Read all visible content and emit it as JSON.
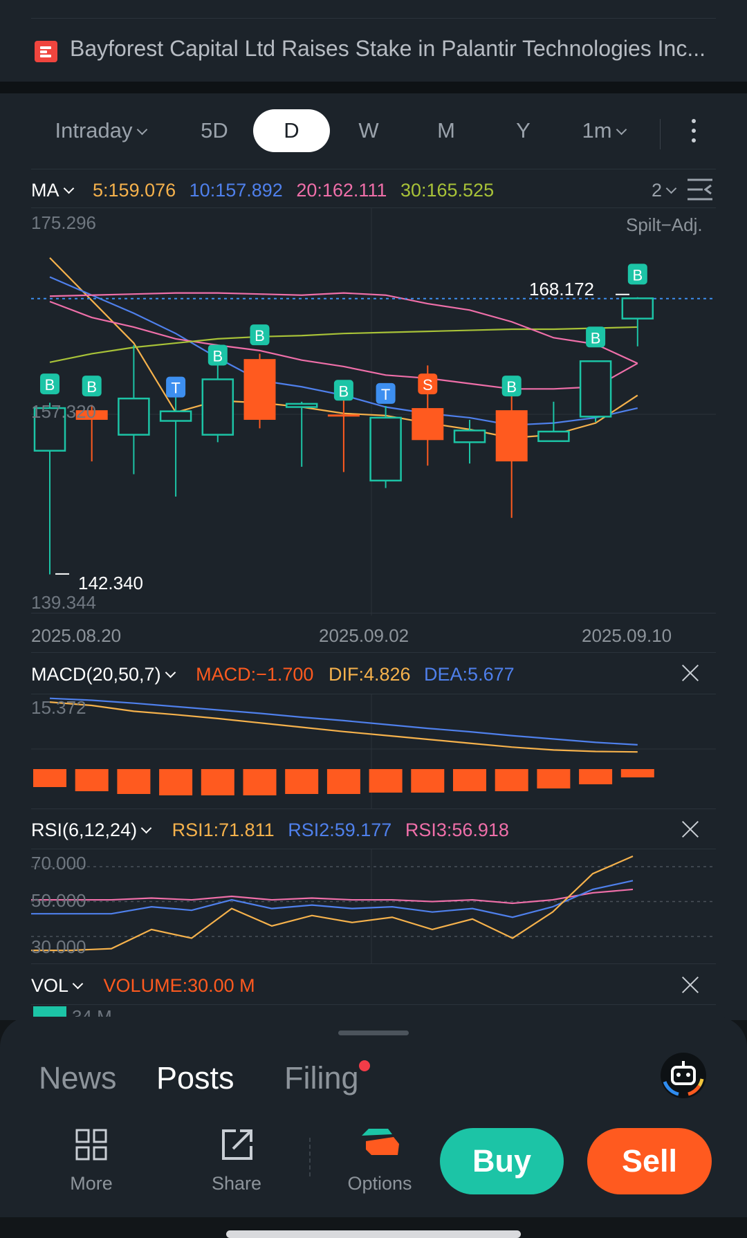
{
  "news": {
    "text": "Bayforest Capital Ltd Raises Stake in Palantir Technologies Inc..."
  },
  "tabs": {
    "intraday": "Intraday",
    "five_day": "5D",
    "day": "D",
    "week": "W",
    "month": "M",
    "year": "Y",
    "interval": "1m"
  },
  "ma": {
    "label": "MA",
    "ma5": "5:159.076",
    "ma10": "10:157.892",
    "ma20": "20:162.111",
    "ma30": "30:165.525",
    "layout_count": "2",
    "split_adj": "Spilt−Adj.",
    "colors": {
      "ma5": "#f6b24c",
      "ma10": "#4f80ec",
      "ma20": "#ef6fa9",
      "ma30": "#a8c238"
    }
  },
  "price_chart": {
    "y_top": "175.296",
    "y_mid": "157.320",
    "y_bottom": "139.344",
    "high_marker": "168.172",
    "low_marker": "142.340",
    "dates": [
      "2025.08.20",
      "2025.09.02",
      "2025.09.10"
    ]
  },
  "chart_data": {
    "type": "candlestick",
    "ylim": [
      139.344,
      175.296
    ],
    "candles": [
      {
        "open": 153.9,
        "close": 157.9,
        "high": 158.4,
        "low": 142.3,
        "up": true,
        "marker": "B"
      },
      {
        "open": 157.7,
        "close": 156.8,
        "high": 158.2,
        "low": 152.9,
        "up": false,
        "marker": "B"
      },
      {
        "open": 155.4,
        "close": 158.8,
        "high": 163.8,
        "low": 151.7,
        "up": true,
        "marker": ""
      },
      {
        "open": 156.7,
        "close": 157.6,
        "high": 159.2,
        "low": 149.6,
        "up": true,
        "marker": "T"
      },
      {
        "open": 155.4,
        "close": 160.6,
        "high": 162.6,
        "low": 154.7,
        "up": true,
        "marker": "B"
      },
      {
        "open": 162.5,
        "close": 156.8,
        "high": 163.0,
        "low": 156.0,
        "up": false,
        "marker": "B"
      },
      {
        "open": 158.0,
        "close": 158.3,
        "high": 158.5,
        "low": 152.4,
        "up": true,
        "marker": ""
      },
      {
        "open": 157.3,
        "close": 157.2,
        "high": 158.9,
        "low": 151.9,
        "up": false,
        "marker": "B"
      },
      {
        "open": 151.1,
        "close": 157.0,
        "high": 158.1,
        "low": 150.4,
        "up": true,
        "marker": "T"
      },
      {
        "open": 157.9,
        "close": 154.9,
        "high": 161.9,
        "low": 152.5,
        "up": false,
        "marker": "S"
      },
      {
        "open": 154.7,
        "close": 155.8,
        "high": 156.8,
        "low": 152.7,
        "up": true,
        "marker": ""
      },
      {
        "open": 157.7,
        "close": 152.9,
        "high": 159.3,
        "low": 147.6,
        "up": false,
        "marker": "B"
      },
      {
        "open": 154.8,
        "close": 155.7,
        "high": 158.5,
        "low": 154.8,
        "up": true,
        "marker": ""
      },
      {
        "open": 157.1,
        "close": 162.3,
        "high": 162.3,
        "low": 156.6,
        "up": true,
        "marker": "B"
      },
      {
        "open": 166.3,
        "close": 168.2,
        "high": 168.3,
        "low": 163.7,
        "up": true,
        "marker": "B"
      }
    ],
    "ma_lines": {
      "ma5": [
        172.0,
        168.0,
        164.0,
        157.5,
        158.6,
        158.4,
        158.0,
        157.4,
        157.2,
        156.5,
        155.9,
        155.1,
        155.4,
        156.5,
        159.1
      ],
      "ma10": [
        170.2,
        168.5,
        166.8,
        164.9,
        162.6,
        160.5,
        159.9,
        159.1,
        158.0,
        157.4,
        157.0,
        156.3,
        156.5,
        157.0,
        157.9
      ],
      "ma20": [
        167.9,
        166.4,
        165.5,
        164.4,
        163.8,
        163.3,
        162.4,
        161.8,
        161.0,
        160.7,
        160.2,
        159.7,
        159.7,
        159.9,
        162.1
      ],
      "ma30": [
        162.2,
        163.0,
        163.6,
        164.0,
        164.4,
        164.6,
        164.7,
        164.9,
        165.0,
        165.1,
        165.2,
        165.3,
        165.3,
        165.4,
        165.5
      ],
      "ma_top": [
        168.4,
        168.5,
        168.6,
        168.7,
        168.7,
        168.6,
        168.5,
        168.7,
        168.5,
        167.7,
        167.1,
        166.0,
        164.5,
        163.9,
        162.1
      ]
    }
  },
  "macd": {
    "label": "MACD(20,50,7)",
    "macd": "MACD:−1.700",
    "dif": "DIF:4.826",
    "dea": "DEA:5.677",
    "y_top": "15.372",
    "histogram": [
      -1.3,
      -1.6,
      -1.8,
      -1.9,
      -1.9,
      -1.9,
      -1.8,
      -1.8,
      -1.7,
      -1.7,
      -1.6,
      -1.6,
      -1.4,
      -1.1,
      -0.6
    ],
    "dif_line": [
      15.1,
      14.4,
      13.2,
      12.5,
      11.7,
      10.8,
      9.9,
      9.0,
      8.2,
      7.4,
      6.6,
      5.8,
      5.2,
      4.9,
      4.8
    ],
    "dea_line": [
      15.3,
      14.9,
      14.3,
      13.6,
      12.9,
      12.2,
      11.4,
      10.7,
      9.9,
      9.1,
      8.4,
      7.6,
      6.9,
      6.2,
      5.7
    ],
    "colors": {
      "macd": "#ff5a1f",
      "dif": "#f6b24c",
      "dea": "#4f80ec"
    }
  },
  "rsi": {
    "label": "RSI(6,12,24)",
    "rsi1": "RSI1:71.811",
    "rsi2": "RSI2:59.177",
    "rsi3": "RSI3:56.918",
    "levels": [
      "70.000",
      "50.000",
      "30.000"
    ],
    "rsi1_line": [
      22,
      22,
      23,
      34,
      29,
      46,
      36,
      42,
      38,
      41,
      34,
      40,
      29,
      44,
      66,
      76
    ],
    "rsi2_line": [
      43,
      43,
      43,
      47,
      45,
      51,
      46,
      48,
      46,
      47,
      44,
      46,
      41,
      47,
      57,
      62
    ],
    "rsi3_line": [
      51,
      51,
      51,
      52,
      51,
      53,
      51,
      52,
      51,
      51,
      50,
      51,
      49,
      51,
      55,
      57
    ],
    "colors": {
      "rsi1": "#f6b24c",
      "rsi2": "#4f80ec",
      "rsi3": "#ef6fa9"
    }
  },
  "vol": {
    "label": "VOL",
    "volume": "VOLUME:30.00 M",
    "y_top": "34 M"
  },
  "bottom": {
    "tabs": [
      "News",
      "Posts",
      "Filing"
    ],
    "more": "More",
    "share": "Share",
    "options": "Options",
    "buy": "Buy",
    "sell": "Sell",
    "colors": {
      "buy": "#1cc4a6",
      "sell": "#ff5a1f"
    }
  }
}
